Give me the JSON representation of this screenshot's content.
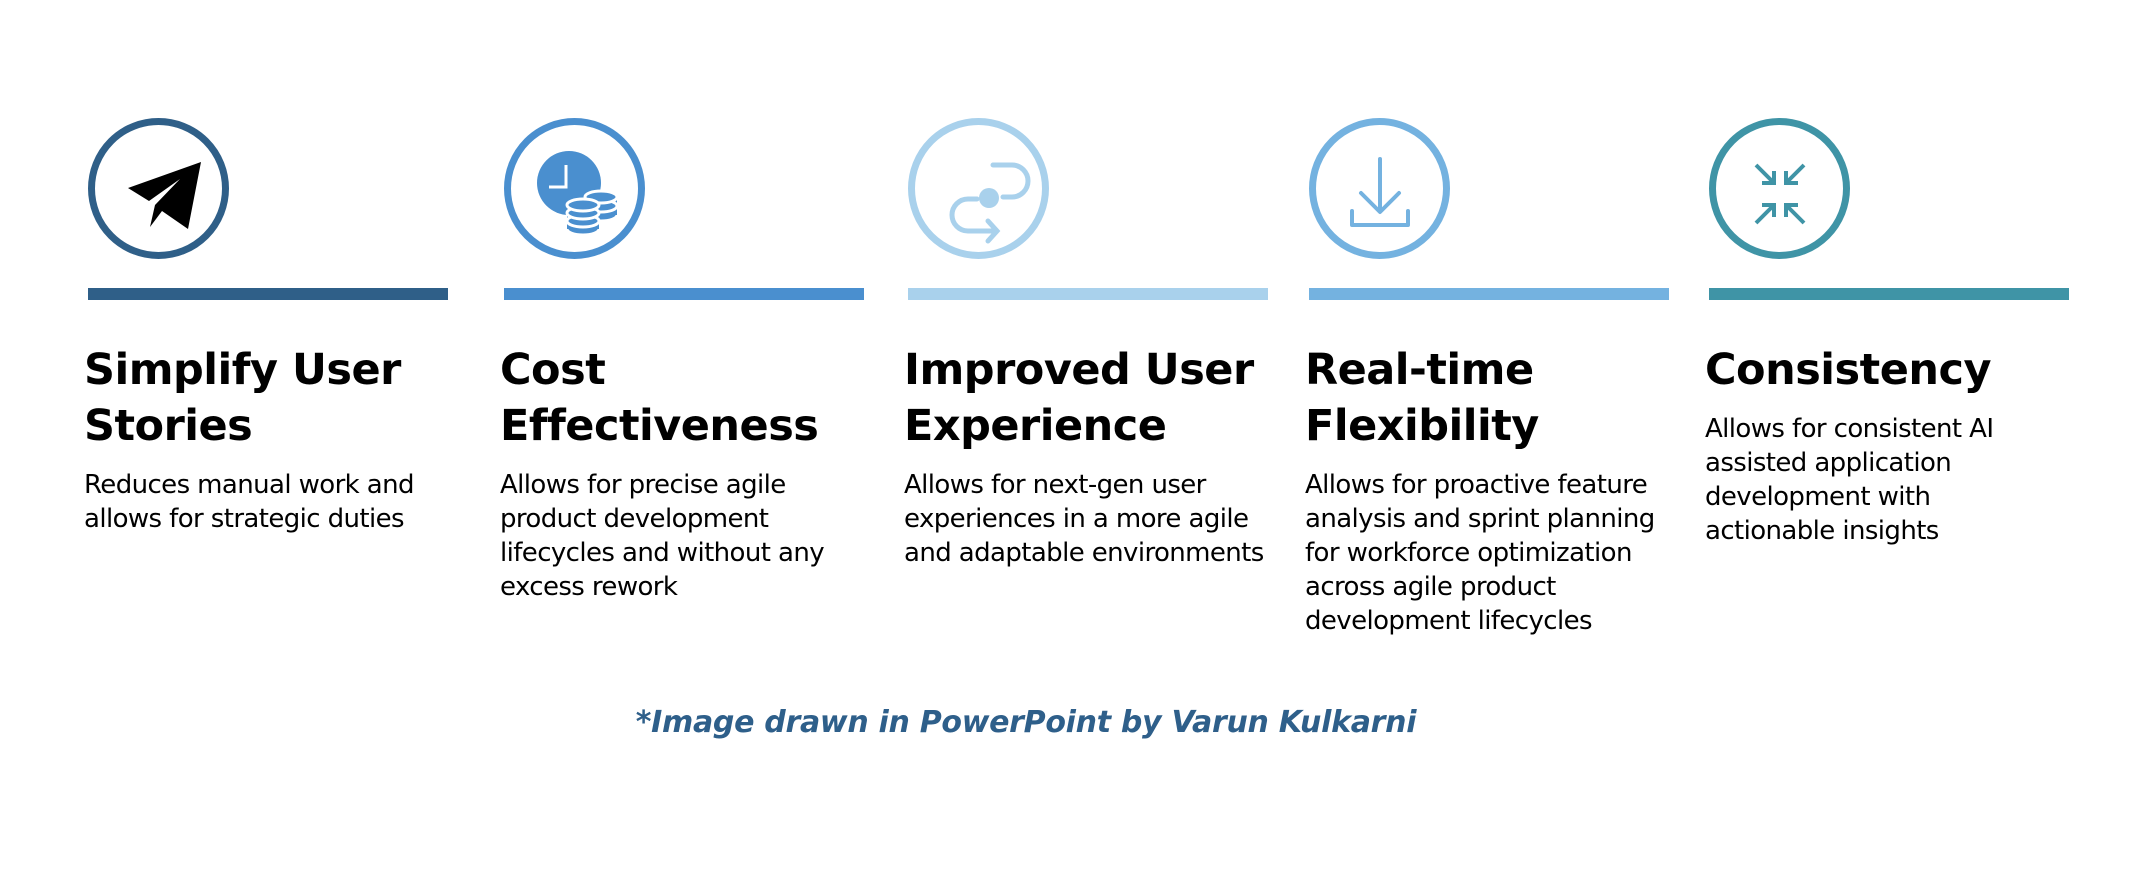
{
  "columns": [
    {
      "title": "Simplify User Stories",
      "title_lines": [
        "Simplify User",
        "Stories"
      ],
      "description": "Reduces manual work and allows for strategic duties",
      "icon": "paper-plane-icon",
      "color": "#2f5f88"
    },
    {
      "title": "Cost Effectiveness",
      "title_lines": [
        "Cost",
        "Effectiveness"
      ],
      "description": "Allows for precise agile product development lifecycles and without any excess rework",
      "icon": "clock-coins-icon",
      "color": "#4a8fcf"
    },
    {
      "title": "Improved User Experience",
      "title_lines": [
        "Improved User",
        "Experience"
      ],
      "description": "Allows for next-gen user experiences in a more agile and adaptable environments",
      "icon": "route-path-icon",
      "color": "#a9d1ec"
    },
    {
      "title": "Real-time Flexibility",
      "title_lines": [
        "Real-time",
        "Flexibility"
      ],
      "description": "Allows for proactive feature analysis and sprint planning for workforce optimization across agile product development lifecycles",
      "icon": "download-icon",
      "color": "#74b2e0"
    },
    {
      "title": "Consistency",
      "title_lines": [
        "Consistency"
      ],
      "description": "Allows for consistent AI assisted application development with actionable insights",
      "icon": "collapse-arrows-icon",
      "color": "#3f94a6"
    }
  ],
  "footer": {
    "credit": "*Image drawn in PowerPoint by Varun Kulkarni",
    "color": "#2e5f8a"
  }
}
